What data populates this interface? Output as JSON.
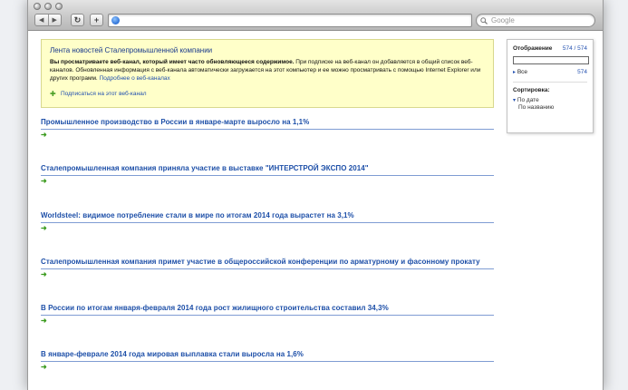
{
  "browser": {
    "back_label": "◀",
    "forward_label": "▶",
    "reload_label": "↻",
    "add_label": "+",
    "address_value": "",
    "search_placeholder": "Google"
  },
  "feed_info": {
    "title": "Лента новостей Сталепромышленной компании",
    "bold_text": "Вы просматриваете веб-канал, который имеет часто обновляющееся содержимое.",
    "text": " При подписке на веб-канал он добавляется в общий список веб-каналов. Обновленная информация с веб-канала автоматически загружается на этот компьютер и ее можно просматривать с помощью Internet Explorer или других программ.",
    "more_link": "Подробнее о веб-каналах",
    "subscribe_link": "Подписаться на этот веб-канал"
  },
  "articles": [
    {
      "title": "Промышленное производство в России в январе-марте выросло на 1,1%"
    },
    {
      "title": "Сталепромышленная компания приняла участие в выставке \"ИНТЕРСТРОЙ ЭКСПО 2014\""
    },
    {
      "title": "Worldsteel: видимое потребление стали в мире по итогам 2014 года вырастет на 3,1%"
    },
    {
      "title": "Сталепромышленная компания примет участие в общероссийской конференции по арматурному и фасонному прокату"
    },
    {
      "title": "В России по итогам января-февраля 2014 года рост жилищного строительства составил 34,3%"
    },
    {
      "title": "В январе-феврале 2014 года мировая выплавка стали выросла на 1,6%"
    }
  ],
  "sidebar": {
    "display_label": "Отображение",
    "display_count": "574 / 574",
    "filter_value": "",
    "all_label": "Все",
    "all_count": "574",
    "sort_label": "Сортировка:",
    "sort_by_date": "По дате",
    "sort_by_name": "По названию"
  },
  "colors": {
    "link": "#2250b0",
    "info_background": "#ffffc9",
    "arrow": "#3a9a1d"
  }
}
